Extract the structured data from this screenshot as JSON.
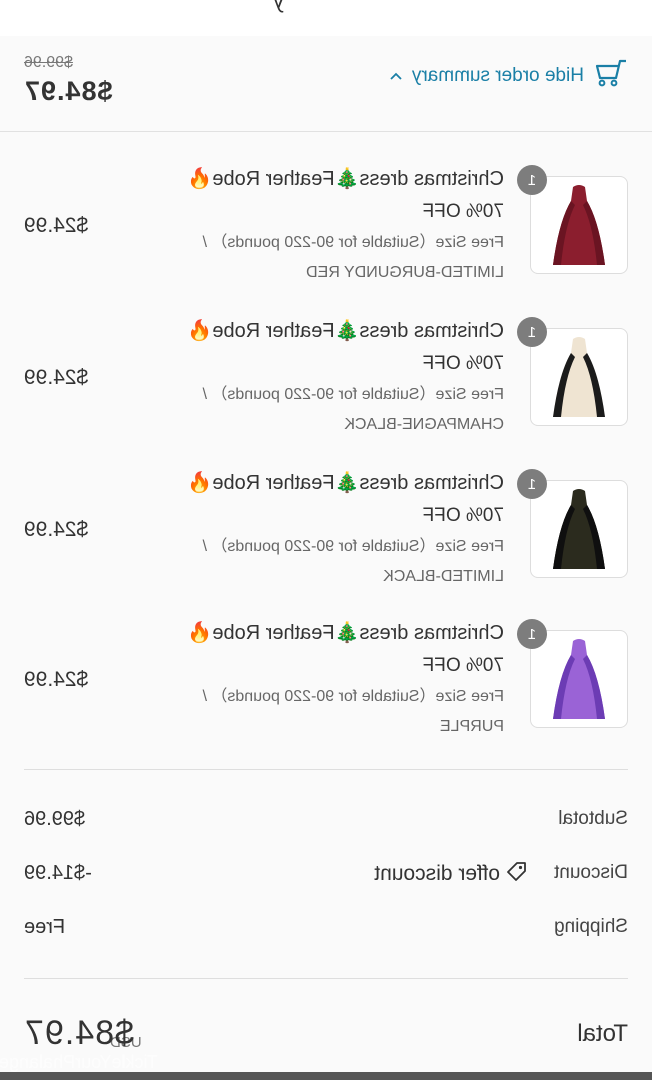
{
  "header": {
    "cut_text": "y"
  },
  "summary_toggle": {
    "label": "Hide order summary",
    "original_price": "$99.96",
    "current_price": "$84.97"
  },
  "items": [
    {
      "qty": "1",
      "title": "Christmas dress🎄Feather Robe🔥",
      "discount_tag": "70% OFF",
      "variant_line1": "Free Size（Suitable for 90-220 pounds） /",
      "variant_line2": "LIMITED-BURGUNDY RED",
      "price": "$24.99",
      "color_main": "#8b1e2e",
      "color_trim": "#6a1422"
    },
    {
      "qty": "1",
      "title": "Christmas dress🎄Feather Robe🔥",
      "discount_tag": "70% OFF",
      "variant_line1": "Free Size（Suitable for 90-220 pounds） /",
      "variant_line2": "CHAMPAGNE-BLACK",
      "price": "$24.99",
      "color_main": "#efe4d2",
      "color_trim": "#1b1b1b"
    },
    {
      "qty": "1",
      "title": "Christmas dress🎄Feather Robe🔥",
      "discount_tag": "70% OFF",
      "variant_line1": "Free Size（Suitable for 90-220 pounds） /",
      "variant_line2": "LIMITED-BLACK",
      "price": "$24.99",
      "color_main": "#2b2b1e",
      "color_trim": "#0f0f0f"
    },
    {
      "qty": "1",
      "title": "Christmas dress🎄Feather Robe🔥",
      "discount_tag": "70% OFF",
      "variant_line1": "Free Size（Suitable for 90-220 pounds） /",
      "variant_line2": "PURPLE",
      "price": "$24.99",
      "color_main": "#9a63d6",
      "color_trim": "#6c3cb4"
    }
  ],
  "totals": {
    "subtotal_label": "Subtotal",
    "subtotal_value": "$99.96",
    "discount_label": "Discount",
    "discount_code": "offer discount",
    "discount_value": "-$14.99",
    "shipping_label": "Shipping",
    "shipping_value": "Free",
    "total_label": "Total",
    "total_currency": "USD",
    "total_value": "$84.97"
  },
  "watermark": "TickleYourPhalanges",
  "colors": {
    "link": "#1a7fa6",
    "panel": "#fafafa",
    "badge": "#7d7d7d"
  }
}
